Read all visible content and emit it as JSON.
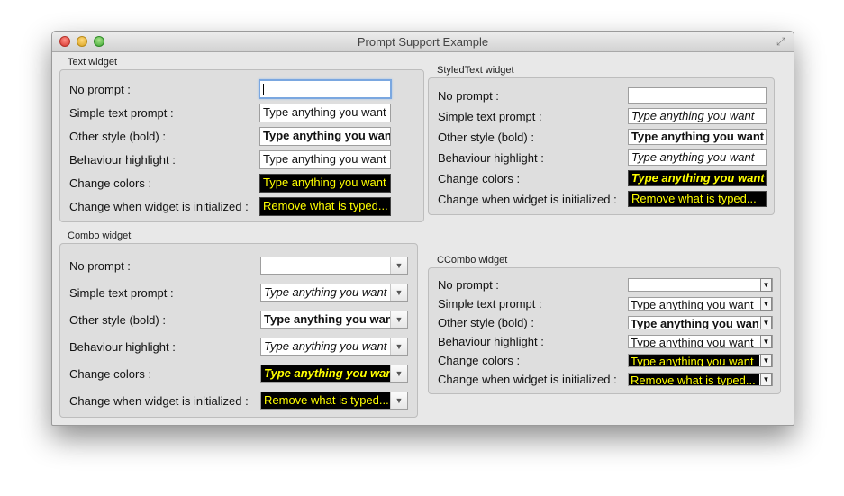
{
  "window": {
    "title": "Prompt Support Example"
  },
  "text_widget": {
    "group_title": "Text widget",
    "rows": [
      {
        "label": "No prompt :",
        "value": ""
      },
      {
        "label": "Simple text prompt :",
        "value": "Type anything you want"
      },
      {
        "label": "Other style (bold) :",
        "value": "Type anything you want"
      },
      {
        "label": "Behaviour highlight :",
        "value": "Type anything you want"
      },
      {
        "label": "Change colors :",
        "value": "Type anything you want"
      },
      {
        "label": "Change when widget is initialized :",
        "value": "Remove what is typed..."
      }
    ]
  },
  "styledtext_widget": {
    "group_title": "StyledText widget",
    "rows": [
      {
        "label": "No prompt :",
        "value": ""
      },
      {
        "label": "Simple text prompt :",
        "value": "Type anything you want"
      },
      {
        "label": "Other style (bold) :",
        "value": "Type anything you want"
      },
      {
        "label": "Behaviour highlight :",
        "value": "Type anything you want"
      },
      {
        "label": "Change colors :",
        "value": "Type anything you want"
      },
      {
        "label": "Change when widget is initialized :",
        "value": "Remove what is typed..."
      }
    ]
  },
  "combo_widget": {
    "group_title": "Combo widget",
    "rows": [
      {
        "label": "No prompt :",
        "value": ""
      },
      {
        "label": "Simple text prompt :",
        "value": "Type anything you want"
      },
      {
        "label": "Other style (bold) :",
        "value": "Type anything you want"
      },
      {
        "label": "Behaviour highlight :",
        "value": "Type anything you want"
      },
      {
        "label": "Change colors :",
        "value": "Type anything you want"
      },
      {
        "label": "Change when widget is initialized :",
        "value": "Remove what is typed..."
      }
    ]
  },
  "ccombo_widget": {
    "group_title": "CCombo widget",
    "rows": [
      {
        "label": "No prompt :",
        "value": ""
      },
      {
        "label": "Simple text prompt :",
        "value": "Type anything you want"
      },
      {
        "label": "Other style (bold) :",
        "value": "Type anything you want"
      },
      {
        "label": "Behaviour highlight :",
        "value": "Type anything you want"
      },
      {
        "label": "Change colors :",
        "value": "Type anything you want"
      },
      {
        "label": "Change when widget is initialized :",
        "value": "Remove what is typed..."
      }
    ]
  },
  "colors": {
    "prompt_background": "#000000",
    "prompt_foreground": "#ffff00",
    "focus_ring": "#7aa7e0"
  },
  "icons": {
    "combo_arrow": "chevron-down-icon",
    "fullscreen": "fullscreen-icon"
  }
}
